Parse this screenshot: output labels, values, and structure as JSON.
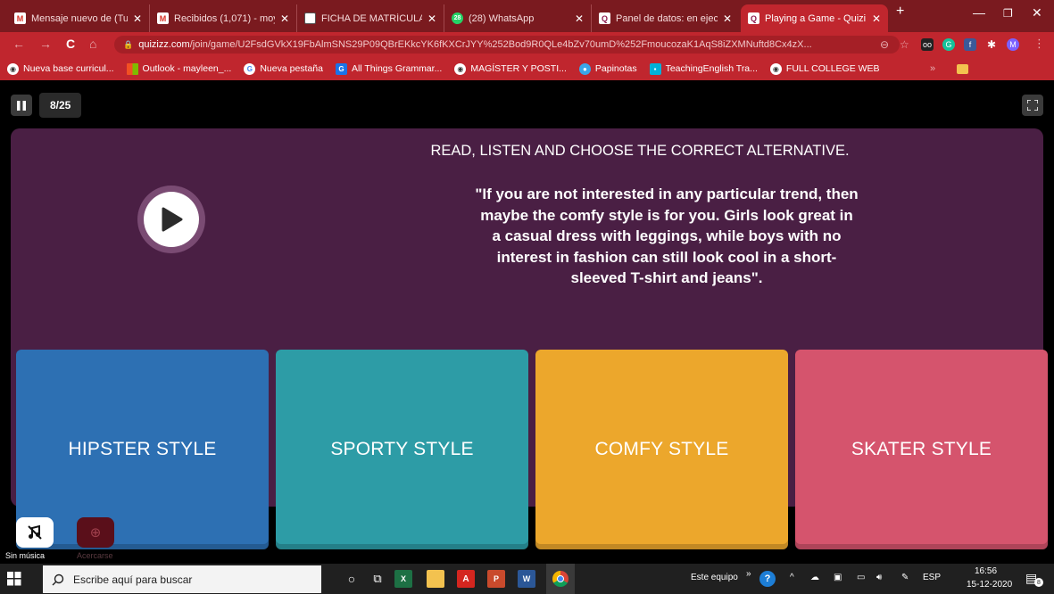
{
  "tabs": [
    {
      "title": "Mensaje nuevo de (Tuto",
      "icon": "gmail-icon",
      "fav": "M"
    },
    {
      "title": "Recibidos (1,071) - moy",
      "icon": "gmail-icon",
      "fav": "M"
    },
    {
      "title": "FICHA DE MATRÍCULA E",
      "icon": "document-icon",
      "fav": "F"
    },
    {
      "title": "(28) WhatsApp",
      "icon": "whatsapp-icon",
      "fav": "28"
    },
    {
      "title": "Panel de datos: en ejecu",
      "icon": "quizizz-icon",
      "fav": "Q"
    },
    {
      "title": "Playing a Game - Quizi",
      "icon": "quizizz-icon",
      "fav": "Q"
    }
  ],
  "address": {
    "domain": "quizizz.com",
    "path": "/join/game/U2FsdGVkX19FbAlmSNS29P09QBrEKkcYK6fKXCrJYY%252Bod9R0QLe4bZv70umD%252FmoucozaK1AqS8iZXMNuftd8Cx4zX..."
  },
  "profile_initial": "M",
  "bookmarks": [
    {
      "label": "Nueva base curricul...",
      "icon": "globe-icon"
    },
    {
      "label": "Outlook - mayleen_...",
      "icon": "microsoft-icon"
    },
    {
      "label": "Nueva pestaña",
      "icon": "google-icon"
    },
    {
      "label": "All Things Grammar...",
      "icon": "g-icon"
    },
    {
      "label": "MAGÍSTER Y POSTI...",
      "icon": "globe-icon"
    },
    {
      "label": "Papinotas",
      "icon": "papinotas-icon"
    },
    {
      "label": "TeachingEnglish Tra...",
      "icon": "teachingenglish-icon"
    },
    {
      "label": "FULL COLLEGE WEB",
      "icon": "globe-icon"
    }
  ],
  "game": {
    "counter": "8/25",
    "question_title": "READ, LISTEN AND CHOOSE THE CORRECT ALTERNATIVE.",
    "question_text": "\"If you are not interested in any particular trend, then maybe the comfy style is for you. Girls look great in a casual dress with leggings, while boys with no interest in fashion can still look cool in a short-sleeved T-shirt and jeans\".",
    "options": [
      {
        "label": "HIPSTER STYLE",
        "color": "#2d70b3"
      },
      {
        "label": "SPORTY STYLE",
        "color": "#2d9ca6"
      },
      {
        "label": "COMFY STYLE",
        "color": "#eca72c"
      },
      {
        "label": "SKATER STYLE",
        "color": "#d5546d"
      }
    ],
    "music_label": "Sin música",
    "zoom_label": "Acercarse"
  },
  "taskbar": {
    "search_placeholder": "Escribe aquí para buscar",
    "location_label": "Este equipo",
    "language": "ESP",
    "time": "16:56",
    "date": "15-12-2020",
    "notification_count": "8"
  },
  "colors": {
    "chrome_frame": "#7a1a1f",
    "chrome_toolbar": "#c0262e",
    "question_bg": "#4a1f44"
  }
}
